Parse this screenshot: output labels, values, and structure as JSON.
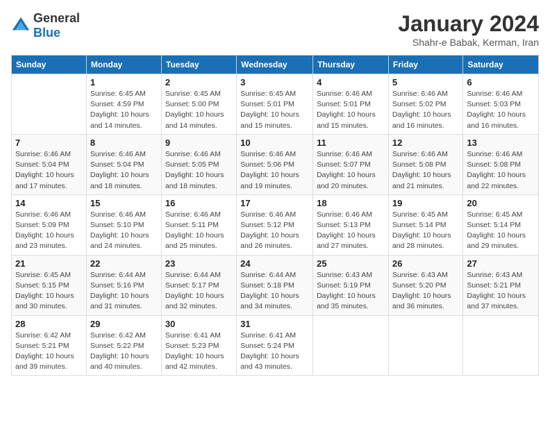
{
  "logo": {
    "text_general": "General",
    "text_blue": "Blue"
  },
  "title": "January 2024",
  "subtitle": "Shahr-e Babak, Kerman, Iran",
  "days_of_week": [
    "Sunday",
    "Monday",
    "Tuesday",
    "Wednesday",
    "Thursday",
    "Friday",
    "Saturday"
  ],
  "weeks": [
    [
      {
        "day": "",
        "sunrise": "",
        "sunset": "",
        "daylight": ""
      },
      {
        "day": "1",
        "sunrise": "Sunrise: 6:45 AM",
        "sunset": "Sunset: 4:59 PM",
        "daylight": "Daylight: 10 hours and 14 minutes."
      },
      {
        "day": "2",
        "sunrise": "Sunrise: 6:45 AM",
        "sunset": "Sunset: 5:00 PM",
        "daylight": "Daylight: 10 hours and 14 minutes."
      },
      {
        "day": "3",
        "sunrise": "Sunrise: 6:45 AM",
        "sunset": "Sunset: 5:01 PM",
        "daylight": "Daylight: 10 hours and 15 minutes."
      },
      {
        "day": "4",
        "sunrise": "Sunrise: 6:46 AM",
        "sunset": "Sunset: 5:01 PM",
        "daylight": "Daylight: 10 hours and 15 minutes."
      },
      {
        "day": "5",
        "sunrise": "Sunrise: 6:46 AM",
        "sunset": "Sunset: 5:02 PM",
        "daylight": "Daylight: 10 hours and 16 minutes."
      },
      {
        "day": "6",
        "sunrise": "Sunrise: 6:46 AM",
        "sunset": "Sunset: 5:03 PM",
        "daylight": "Daylight: 10 hours and 16 minutes."
      }
    ],
    [
      {
        "day": "7",
        "sunrise": "Sunrise: 6:46 AM",
        "sunset": "Sunset: 5:04 PM",
        "daylight": "Daylight: 10 hours and 17 minutes."
      },
      {
        "day": "8",
        "sunrise": "Sunrise: 6:46 AM",
        "sunset": "Sunset: 5:04 PM",
        "daylight": "Daylight: 10 hours and 18 minutes."
      },
      {
        "day": "9",
        "sunrise": "Sunrise: 6:46 AM",
        "sunset": "Sunset: 5:05 PM",
        "daylight": "Daylight: 10 hours and 18 minutes."
      },
      {
        "day": "10",
        "sunrise": "Sunrise: 6:46 AM",
        "sunset": "Sunset: 5:06 PM",
        "daylight": "Daylight: 10 hours and 19 minutes."
      },
      {
        "day": "11",
        "sunrise": "Sunrise: 6:46 AM",
        "sunset": "Sunset: 5:07 PM",
        "daylight": "Daylight: 10 hours and 20 minutes."
      },
      {
        "day": "12",
        "sunrise": "Sunrise: 6:46 AM",
        "sunset": "Sunset: 5:08 PM",
        "daylight": "Daylight: 10 hours and 21 minutes."
      },
      {
        "day": "13",
        "sunrise": "Sunrise: 6:46 AM",
        "sunset": "Sunset: 5:08 PM",
        "daylight": "Daylight: 10 hours and 22 minutes."
      }
    ],
    [
      {
        "day": "14",
        "sunrise": "Sunrise: 6:46 AM",
        "sunset": "Sunset: 5:09 PM",
        "daylight": "Daylight: 10 hours and 23 minutes."
      },
      {
        "day": "15",
        "sunrise": "Sunrise: 6:46 AM",
        "sunset": "Sunset: 5:10 PM",
        "daylight": "Daylight: 10 hours and 24 minutes."
      },
      {
        "day": "16",
        "sunrise": "Sunrise: 6:46 AM",
        "sunset": "Sunset: 5:11 PM",
        "daylight": "Daylight: 10 hours and 25 minutes."
      },
      {
        "day": "17",
        "sunrise": "Sunrise: 6:46 AM",
        "sunset": "Sunset: 5:12 PM",
        "daylight": "Daylight: 10 hours and 26 minutes."
      },
      {
        "day": "18",
        "sunrise": "Sunrise: 6:46 AM",
        "sunset": "Sunset: 5:13 PM",
        "daylight": "Daylight: 10 hours and 27 minutes."
      },
      {
        "day": "19",
        "sunrise": "Sunrise: 6:45 AM",
        "sunset": "Sunset: 5:14 PM",
        "daylight": "Daylight: 10 hours and 28 minutes."
      },
      {
        "day": "20",
        "sunrise": "Sunrise: 6:45 AM",
        "sunset": "Sunset: 5:14 PM",
        "daylight": "Daylight: 10 hours and 29 minutes."
      }
    ],
    [
      {
        "day": "21",
        "sunrise": "Sunrise: 6:45 AM",
        "sunset": "Sunset: 5:15 PM",
        "daylight": "Daylight: 10 hours and 30 minutes."
      },
      {
        "day": "22",
        "sunrise": "Sunrise: 6:44 AM",
        "sunset": "Sunset: 5:16 PM",
        "daylight": "Daylight: 10 hours and 31 minutes."
      },
      {
        "day": "23",
        "sunrise": "Sunrise: 6:44 AM",
        "sunset": "Sunset: 5:17 PM",
        "daylight": "Daylight: 10 hours and 32 minutes."
      },
      {
        "day": "24",
        "sunrise": "Sunrise: 6:44 AM",
        "sunset": "Sunset: 5:18 PM",
        "daylight": "Daylight: 10 hours and 34 minutes."
      },
      {
        "day": "25",
        "sunrise": "Sunrise: 6:43 AM",
        "sunset": "Sunset: 5:19 PM",
        "daylight": "Daylight: 10 hours and 35 minutes."
      },
      {
        "day": "26",
        "sunrise": "Sunrise: 6:43 AM",
        "sunset": "Sunset: 5:20 PM",
        "daylight": "Daylight: 10 hours and 36 minutes."
      },
      {
        "day": "27",
        "sunrise": "Sunrise: 6:43 AM",
        "sunset": "Sunset: 5:21 PM",
        "daylight": "Daylight: 10 hours and 37 minutes."
      }
    ],
    [
      {
        "day": "28",
        "sunrise": "Sunrise: 6:42 AM",
        "sunset": "Sunset: 5:21 PM",
        "daylight": "Daylight: 10 hours and 39 minutes."
      },
      {
        "day": "29",
        "sunrise": "Sunrise: 6:42 AM",
        "sunset": "Sunset: 5:22 PM",
        "daylight": "Daylight: 10 hours and 40 minutes."
      },
      {
        "day": "30",
        "sunrise": "Sunrise: 6:41 AM",
        "sunset": "Sunset: 5:23 PM",
        "daylight": "Daylight: 10 hours and 42 minutes."
      },
      {
        "day": "31",
        "sunrise": "Sunrise: 6:41 AM",
        "sunset": "Sunset: 5:24 PM",
        "daylight": "Daylight: 10 hours and 43 minutes."
      },
      {
        "day": "",
        "sunrise": "",
        "sunset": "",
        "daylight": ""
      },
      {
        "day": "",
        "sunrise": "",
        "sunset": "",
        "daylight": ""
      },
      {
        "day": "",
        "sunrise": "",
        "sunset": "",
        "daylight": ""
      }
    ]
  ]
}
